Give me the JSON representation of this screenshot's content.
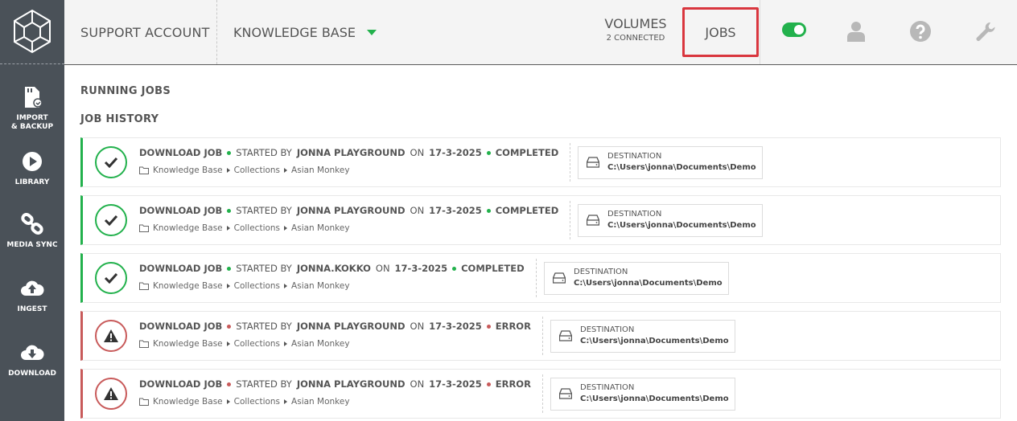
{
  "header": {
    "account": "SUPPORT ACCOUNT",
    "workspace": "KNOWLEDGE BASE",
    "volumes_label": "VOLUMES",
    "volumes_status": "2 CONNECTED",
    "jobs_label": "JOBS"
  },
  "sidebar": {
    "items": [
      {
        "label": "IMPORT\n& BACKUP",
        "icon": "sd-card-icon"
      },
      {
        "label": "LIBRARY",
        "icon": "play-icon"
      },
      {
        "label": "MEDIA SYNC",
        "icon": "link-icon"
      },
      {
        "label": "INGEST",
        "icon": "cloud-upload-icon"
      },
      {
        "label": "DOWNLOAD",
        "icon": "cloud-download-icon"
      }
    ]
  },
  "content": {
    "running_title": "RUNNING JOBS",
    "history_title": "JOB HISTORY",
    "jobs": [
      {
        "type": "DOWNLOAD JOB",
        "started_by_label": "STARTED BY",
        "user": "JONNA PLAYGROUND",
        "on_label": "ON",
        "date": "17-3-2025",
        "status": "COMPLETED",
        "path": [
          "Knowledge Base",
          "Collections",
          "Asian Monkey"
        ],
        "dest_label": "DESTINATION",
        "dest_value": "C:\\Users\\jonna\\Documents\\Demo"
      },
      {
        "type": "DOWNLOAD JOB",
        "started_by_label": "STARTED BY",
        "user": "JONNA PLAYGROUND",
        "on_label": "ON",
        "date": "17-3-2025",
        "status": "COMPLETED",
        "path": [
          "Knowledge Base",
          "Collections",
          "Asian Monkey"
        ],
        "dest_label": "DESTINATION",
        "dest_value": "C:\\Users\\jonna\\Documents\\Demo"
      },
      {
        "type": "DOWNLOAD JOB",
        "started_by_label": "STARTED BY",
        "user": "JONNA.KOKKO",
        "on_label": "ON",
        "date": "17-3-2025",
        "status": "COMPLETED",
        "path": [
          "Knowledge Base",
          "Collections",
          "Asian Monkey"
        ],
        "dest_label": "DESTINATION",
        "dest_value": "C:\\Users\\jonna\\Documents\\Demo"
      },
      {
        "type": "DOWNLOAD JOB",
        "started_by_label": "STARTED BY",
        "user": "JONNA PLAYGROUND",
        "on_label": "ON",
        "date": "17-3-2025",
        "status": "ERROR",
        "path": [
          "Knowledge Base",
          "Collections",
          "Asian Monkey"
        ],
        "dest_label": "DESTINATION",
        "dest_value": "C:\\Users\\jonna\\Documents\\Demo"
      },
      {
        "type": "DOWNLOAD JOB",
        "started_by_label": "STARTED BY",
        "user": "JONNA PLAYGROUND",
        "on_label": "ON",
        "date": "17-3-2025",
        "status": "ERROR",
        "path": [
          "Knowledge Base",
          "Collections",
          "Asian Monkey"
        ],
        "dest_label": "DESTINATION",
        "dest_value": "C:\\Users\\jonna\\Documents\\Demo"
      }
    ]
  },
  "colors": {
    "success": "#22b14c",
    "error": "#c85a5a",
    "highlight": "#d9363e",
    "sidebar": "#4a5158"
  }
}
